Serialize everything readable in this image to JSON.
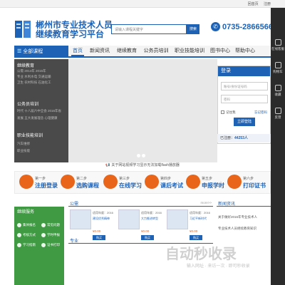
{
  "topbar": {
    "links": [
      "",
      "回首页",
      "注册"
    ]
  },
  "header": {
    "title": "郴州市专业技术人员",
    "subtitle": "继续教育学习平台",
    "search_placeholder": "请输入课程关键字",
    "search_button": "搜索",
    "phone": "0735-2866566"
  },
  "nav": {
    "all_courses": "全部课程",
    "items": [
      "首页",
      "新闻资讯",
      "继续教育",
      "公务员培训",
      "职业技能培训",
      "图书中心",
      "帮助中心"
    ]
  },
  "floatbar": [
    "在线客服",
    "购物车",
    "收藏",
    "反馈"
  ],
  "categories": {
    "groups": [
      {
        "title": "继续教育",
        "lines": [
          "公需     2014年    2015年",
          "专业     水利水电  交通运输",
          "卫生     农村科技  石油化工"
        ]
      },
      {
        "title": "公务员培训",
        "lines": [
          "时代     十八届六中全会  2016年省",
          "发展     五大发展理念  心理健康"
        ]
      },
      {
        "title": "职业技能培训",
        "lines": [
          "汽车维修",
          "职业技能"
        ]
      }
    ]
  },
  "login": {
    "title": "登录",
    "account_placeholder": "账号/身份证号码",
    "password_placeholder": "密码",
    "remember": "记住我",
    "forgot": "忘记密码",
    "button": "立即登陆",
    "registered_label": "已注册：",
    "registered_count": "44253人"
  },
  "notice": "关于网站视频学习显示无法加载flash播放器",
  "steps": [
    {
      "label": "第一步",
      "name": "注册登录"
    },
    {
      "label": "第二步",
      "name": "选购课程"
    },
    {
      "label": "第三步",
      "name": "在线学习"
    },
    {
      "label": "第四步",
      "name": "课后考试"
    },
    {
      "label": "第五步",
      "name": "申报学时"
    },
    {
      "label": "第六步",
      "name": "打印证书"
    }
  ],
  "service": {
    "title": "继续服务",
    "items": [
      "集体报名",
      "常见问题",
      "考核方式",
      "学时申报",
      "学习指南",
      "证书打印"
    ]
  },
  "courses": {
    "sections": [
      "公需",
      "专业"
    ],
    "more": "more>>",
    "items": [
      {
        "line1": "适用年度：2016",
        "line2": "建设优秀精神",
        "price": "¥0.00"
      },
      {
        "line1": "适用年度：2016",
        "line2": "大力推进转型",
        "price": "¥0.00"
      },
      {
        "line1": "适用年度：2016",
        "line2": "习近平新时代",
        "price": "¥0.00"
      }
    ]
  },
  "news": {
    "title": "新闻资讯",
    "items": [
      "关于做好2016年专业技术人",
      "专业技术人员继续教育知识",
      "",
      ""
    ]
  },
  "watermark": {
    "main": "自动秒收录",
    "sub": "输入网址 · 来访一次 · 即可秒收录"
  }
}
